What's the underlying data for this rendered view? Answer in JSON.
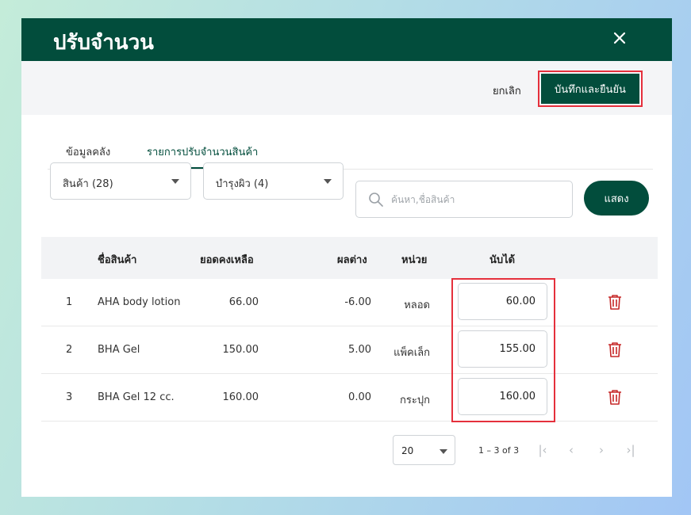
{
  "dialog": {
    "title": "ปรับจำนวน",
    "close_icon": "close-icon"
  },
  "actions": {
    "cancel_label": "ยกเลิก",
    "confirm_label": "บันทึกและยืนยัน"
  },
  "tabs": [
    {
      "label": "ข้อมูลคลัง",
      "active": false
    },
    {
      "label": "รายการปรับจำนวนสินค้า",
      "active": true
    }
  ],
  "filters": {
    "category": "สินค้า (28)",
    "subcategory": "บำรุงผิว (4)",
    "search_placeholder": "ค้นหา,ชื่อสินค้า",
    "search_value": "",
    "show_label": "แสดง"
  },
  "table": {
    "headers": {
      "name": "ชื่อสินค้า",
      "balance": "ยอดคงเหลือ",
      "diff": "ผลต่าง",
      "unit": "หน่วย",
      "counted": "นับได้"
    },
    "rows": [
      {
        "no": "1",
        "name": "AHA body lotion",
        "balance": "66.00",
        "diff": "-6.00",
        "unit": "หลอด",
        "counted": "60.00"
      },
      {
        "no": "2",
        "name": "BHA Gel",
        "balance": "150.00",
        "diff": "5.00",
        "unit": "แพ็คเล็ก",
        "counted": "155.00"
      },
      {
        "no": "3",
        "name": "BHA Gel 12 cc.",
        "balance": "160.00",
        "diff": "0.00",
        "unit": "กระปุก",
        "counted": "160.00"
      }
    ]
  },
  "pagination": {
    "page_size": "20",
    "range": "1 – 3 of 3"
  },
  "colors": {
    "brand": "#024d3c",
    "highlight": "#e5303c",
    "trash": "#c62828"
  }
}
